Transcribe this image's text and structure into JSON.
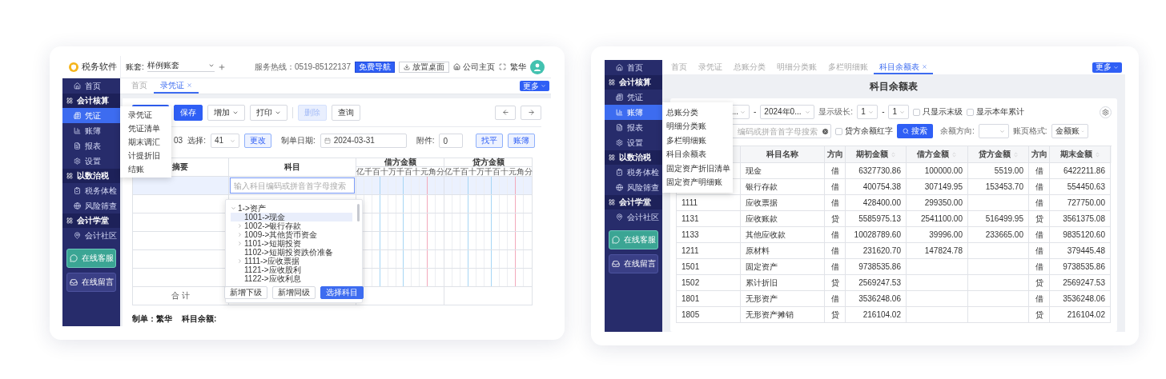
{
  "left_app": {
    "header": {
      "logo": "税务软件",
      "account_label": "账套:",
      "account_value": "样例账套",
      "hotline": "服务热线：0519-85122137",
      "buttons": [
        {
          "label": "免费导航",
          "kind": "primary"
        },
        {
          "label": "放置桌面",
          "kind": "download"
        },
        {
          "label": "公司主页",
          "kind": "home"
        }
      ],
      "user": "繁华"
    },
    "sidebar": [
      {
        "label": "首页",
        "kind": "item",
        "selected": false
      },
      {
        "label": "会计核算",
        "kind": "section"
      },
      {
        "label": "凭证",
        "kind": "item",
        "selected": true
      },
      {
        "label": "账簿",
        "kind": "item",
        "selected": false
      },
      {
        "label": "报表",
        "kind": "item",
        "selected": false
      },
      {
        "label": "设置",
        "kind": "item",
        "selected": false
      },
      {
        "label": "以数治税",
        "kind": "section"
      },
      {
        "label": "税务体检",
        "kind": "item",
        "selected": false
      },
      {
        "label": "风险筛查",
        "kind": "item",
        "selected": false
      },
      {
        "label": "会计学堂",
        "kind": "section"
      },
      {
        "label": "会计社区",
        "kind": "item",
        "selected": false
      },
      {
        "label": "在线客服",
        "kind": "chat_button"
      },
      {
        "label": "在线留言",
        "kind": "message_button"
      }
    ],
    "submenu": [
      "录凭证",
      "凭证清单",
      "期末调汇",
      "计提折旧",
      "结账"
    ],
    "tabs": [
      {
        "label": "首页",
        "selected": false
      },
      {
        "label": "录凭证",
        "selected": true
      }
    ],
    "more_button": "更多",
    "toolbar": [
      {
        "label": "保存",
        "kind": "primary"
      },
      {
        "label": "增加",
        "kind": "dropdown"
      },
      {
        "label": "打印",
        "kind": "dropdown"
      },
      {
        "label": "删除",
        "kind": "disabled"
      },
      {
        "label": "查询",
        "kind": "plain"
      }
    ],
    "form": {
      "voucher_number": "03",
      "select_label": "选择:",
      "select_value": "41",
      "change_button": "更改",
      "date_label": "制单日期:",
      "date_value": "2024-03-31",
      "attachments_label": "附件:",
      "attachments_value": "0",
      "buttons": [
        "找平",
        "账簿"
      ]
    },
    "table": {
      "columns": [
        "摘要",
        "科目",
        "借方金额",
        "贷方金额"
      ],
      "debit_units": [
        "亿",
        "千",
        "百",
        "十",
        "万",
        "千",
        "百",
        "十",
        "元",
        "角",
        "分"
      ],
      "credit_units": [
        "亿",
        "千",
        "百",
        "十",
        "万",
        "千",
        "百",
        "十",
        "元",
        "角",
        "分"
      ],
      "rows": [
        {
          "selected": true
        },
        {
          "selected": false
        },
        {
          "selected": false
        },
        {
          "selected": false
        },
        {
          "selected": false
        },
        {
          "selected": false
        }
      ],
      "subject_search": {
        "placeholder": "输入科目编码或拼音首字母搜索"
      },
      "total_label": "合 计"
    },
    "subject_picker": {
      "root": {
        "label": "1->资产",
        "expanded": true,
        "selected": false,
        "children": [
          {
            "label": "1001->现金",
            "kind": "leaf",
            "selected": true
          },
          {
            "label": "1002->银行存款",
            "kind": "branch",
            "selected": false
          },
          {
            "label": "1009->其他货币资金",
            "kind": "branch",
            "selected": false
          },
          {
            "label": "1101->短期投资",
            "kind": "branch",
            "selected": false
          },
          {
            "label": "1102->短期投资跌价准备",
            "kind": "leaf",
            "selected": false
          },
          {
            "label": "1111->应收票据",
            "kind": "branch",
            "selected": false
          },
          {
            "label": "1121->应收股利",
            "kind": "leaf",
            "selected": false
          },
          {
            "label": "1122->应收利息",
            "kind": "leaf",
            "selected": false
          }
        ]
      },
      "buttons": [
        {
          "label": "新增下级",
          "kind": "plain"
        },
        {
          "label": "新增同级",
          "kind": "plain"
        },
        {
          "label": "选择科目",
          "kind": "primary"
        }
      ]
    },
    "footer": [
      "制单：繁华",
      "科目余额:"
    ]
  },
  "right_app": {
    "sidebar": [
      {
        "label": "首页",
        "kind": "item",
        "selected": false
      },
      {
        "label": "会计核算",
        "kind": "section"
      },
      {
        "label": "凭证",
        "kind": "item",
        "selected": false
      },
      {
        "label": "账簿",
        "kind": "item",
        "selected": true
      },
      {
        "label": "报表",
        "kind": "item",
        "selected": false
      },
      {
        "label": "设置",
        "kind": "item",
        "selected": false
      },
      {
        "label": "以数治税",
        "kind": "section"
      },
      {
        "label": "税务体检",
        "kind": "item",
        "selected": false
      },
      {
        "label": "风险筛查",
        "kind": "item",
        "selected": false
      },
      {
        "label": "会计学堂",
        "kind": "section"
      },
      {
        "label": "会计社区",
        "kind": "item",
        "selected": false
      },
      {
        "label": "在线客服",
        "kind": "chat_button"
      },
      {
        "label": "在线留言",
        "kind": "message_button"
      }
    ],
    "tabs": [
      {
        "label": "首页",
        "selected": false
      },
      {
        "label": "录凭证",
        "selected": false
      },
      {
        "label": "总账分类",
        "selected": false
      },
      {
        "label": "明细分类账",
        "selected": false
      },
      {
        "label": "多栏明细账",
        "selected": false
      },
      {
        "label": "科目余额表",
        "selected": true
      }
    ],
    "more_button": "更多",
    "title": "科目余额表",
    "menu": [
      "总账分类",
      "明细分类账",
      "多栏明细账",
      "科目余额表",
      "固定资产折旧清单",
      "固定资产明细账"
    ],
    "filters": {
      "period_from": "...",
      "period_separator": "-",
      "period_to": "2024年0...",
      "level_label": "显示级长:",
      "level_from": "1",
      "level_separator": "-",
      "level_to": "1",
      "checkboxes": [
        {
          "label": "只显示末级",
          "checked": false
        },
        {
          "label": "显示本年累计",
          "checked": false
        }
      ],
      "direction_label": "余额方向:",
      "format_label": "账页格式:",
      "format_value": "金额账"
    },
    "search": {
      "placeholder": "编码或拼音首字母搜索",
      "red_credit": {
        "label": "贷方余额红字",
        "checked": false
      },
      "button": "搜索"
    },
    "table": {
      "columns": [
        {
          "label": "科目名称",
          "sortable": false
        },
        {
          "label": "方向",
          "sortable": false
        },
        {
          "label": "期初金额",
          "sortable": true
        },
        {
          "label": "借方金额",
          "sortable": true
        },
        {
          "label": "贷方金额",
          "sortable": true
        },
        {
          "label": "方向",
          "sortable": false
        },
        {
          "label": "期末金额",
          "sortable": true
        }
      ],
      "rows": [
        {
          "name": "现金",
          "direction": "借",
          "opening": "6327730.86",
          "debit": "100000.00",
          "credit": "5519.00",
          "end_direction": "借",
          "closing": "6422211.86"
        },
        {
          "name": "银行存款",
          "direction": "借",
          "opening": "400754.38",
          "debit": "307149.95",
          "credit": "153453.70",
          "end_direction": "借",
          "closing": "554450.63"
        },
        {
          "code": "1111",
          "name": "应收票据",
          "direction": "借",
          "opening": "428400.00",
          "debit": "299350.00",
          "end_direction": "借",
          "closing": "727750.00"
        },
        {
          "code": "1131",
          "name": "应收账款",
          "direction": "贷",
          "opening": "5585975.13",
          "debit": "2541100.00",
          "credit": "516499.95",
          "end_direction": "贷",
          "closing": "3561375.08"
        },
        {
          "code": "1133",
          "name": "其他应收款",
          "direction": "借",
          "opening": "10028789.60",
          "debit": "39996.00",
          "credit": "233665.00",
          "end_direction": "借",
          "closing": "9835120.60"
        },
        {
          "code": "1211",
          "name": "原材料",
          "direction": "借",
          "opening": "231620.70",
          "debit": "147824.78",
          "end_direction": "借",
          "closing": "379445.48"
        },
        {
          "code": "1501",
          "name": "固定资产",
          "direction": "借",
          "opening": "9738535.86",
          "end_direction": "借",
          "closing": "9738535.86"
        },
        {
          "code": "1502",
          "name": "累计折旧",
          "direction": "贷",
          "opening": "2569247.53",
          "end_direction": "贷",
          "closing": "2569247.53"
        },
        {
          "code": "1801",
          "name": "无形资产",
          "direction": "借",
          "opening": "3536248.06",
          "end_direction": "借",
          "closing": "3536248.06"
        },
        {
          "code": "1805",
          "name": "无形资产摊销",
          "direction": "贷",
          "opening": "216104.02",
          "end_direction": "贷",
          "closing": "216104.02"
        }
      ]
    }
  }
}
